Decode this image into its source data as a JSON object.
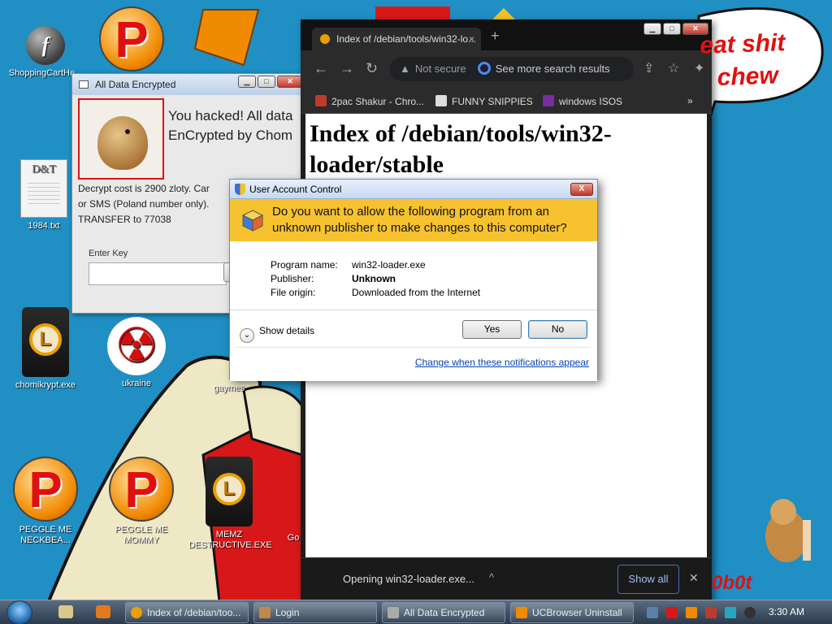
{
  "desktop": {
    "icons": [
      {
        "label": "ShoppingCartHe..."
      },
      {
        "label": "1984.txt"
      },
      {
        "label": "chomikrypt.exe"
      },
      {
        "label": "ukraine"
      },
      {
        "label": "gaymes"
      },
      {
        "label": "PEGGLE ME NECKBEA..."
      },
      {
        "label": "PEGGLE ME MOMMY"
      },
      {
        "label": "MEMZ DESTRUCTIVE.EXE"
      },
      {
        "label": "Go"
      }
    ],
    "speech_text_line1": "eat shit",
    "speech_text_line2": "chew",
    "corner_text": "0b0t",
    "colors": {
      "desktop_blue": "#1f8fc4",
      "speech_red": "#e01010"
    }
  },
  "ransom_window": {
    "title": "All Data Encrypted",
    "headline_line1": "You hacked! All data",
    "headline_line2": "EnCrypted by Chom",
    "body_line1": "Decrypt cost is 2900 zloty. Car",
    "body_line2": "or SMS (Poland number only).",
    "body_line3": "TRANSFER to 77038",
    "enter_key_label": "Enter Key"
  },
  "browser": {
    "tab_title": "Index of /debian/tools/win32-lo...",
    "tab_close": "×",
    "new_tab": "+",
    "not_secure": "Not secure",
    "omnibox_text": "See more search results",
    "bookmarks": [
      {
        "label": "2pac Shakur - Chro...",
        "icon_color": "#c0392b"
      },
      {
        "label": "FUNNY SNIPPIES",
        "icon_color": "#dddddd"
      },
      {
        "label": "windows ISOS",
        "icon_color": "#7a2c9e"
      }
    ],
    "bookmarks_more": "»",
    "page_heading": "Index of /debian/tools/win32-loader/stable",
    "download_item": "Opening win32-loader.exe...",
    "download_caret": "^",
    "show_all": "Show all",
    "downloads_close": "✕"
  },
  "uac": {
    "title": "User Account Control",
    "close_label": "X",
    "question": "Do you want to allow the following program from an unknown publisher to make changes to this computer?",
    "details": [
      {
        "key": "Program name:",
        "value": "win32-loader.exe",
        "bold": false
      },
      {
        "key": "Publisher:",
        "value": "Unknown",
        "bold": true
      },
      {
        "key": "File origin:",
        "value": "Downloaded from the Internet",
        "bold": false
      }
    ],
    "show_details": "Show details",
    "yes_label": "Yes",
    "no_label": "No",
    "change_link": "Change when these notifications appear",
    "colors": {
      "banner_yellow": "#f7c22f",
      "link_blue": "#0645ad"
    }
  },
  "taskbar": {
    "buttons": [
      {
        "label": "Index of /debian/too...",
        "icon_color": "#e8a000"
      },
      {
        "label": "Login",
        "icon_color": "#c08a4a"
      },
      {
        "label": "All Data Encrypted",
        "icon_color": "#aaaaaa"
      },
      {
        "label": "UCBrowser Uninstall",
        "icon_color": "#f08a00"
      }
    ],
    "clock": "3:30 AM"
  }
}
